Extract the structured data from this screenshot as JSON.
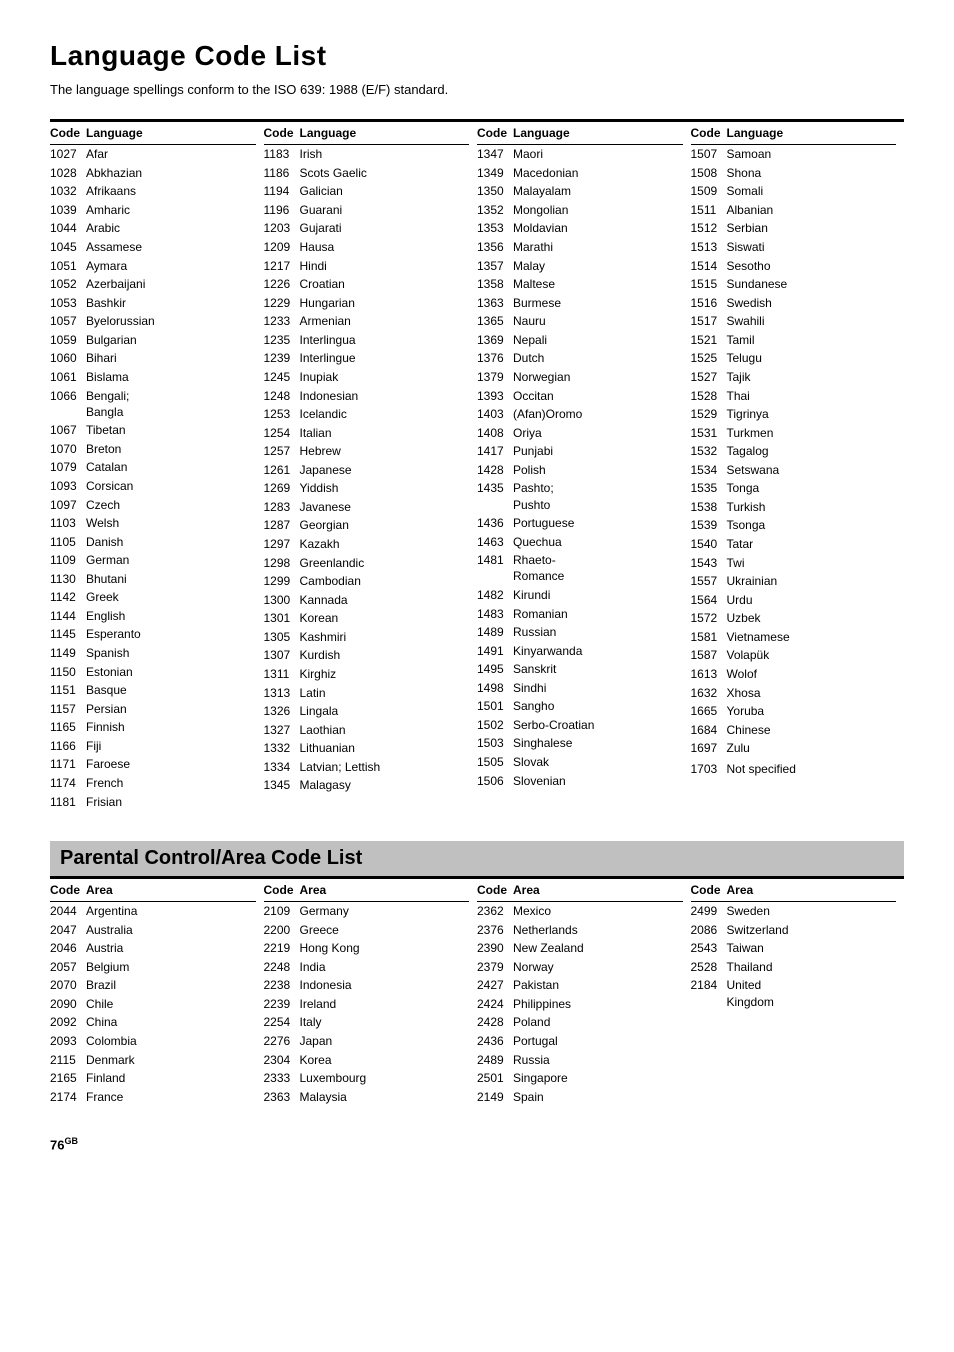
{
  "title": "Language Code List",
  "subtitle": "The language spellings conform to the ISO 639: 1988 (E/F) standard.",
  "lang_table_header": {
    "code": "Code",
    "language": "Language"
  },
  "lang_columns": [
    [
      {
        "code": "1027",
        "lang": "Afar"
      },
      {
        "code": "1028",
        "lang": "Abkhazian"
      },
      {
        "code": "1032",
        "lang": "Afrikaans"
      },
      {
        "code": "1039",
        "lang": "Amharic"
      },
      {
        "code": "1044",
        "lang": "Arabic"
      },
      {
        "code": "1045",
        "lang": "Assamese"
      },
      {
        "code": "1051",
        "lang": "Aymara"
      },
      {
        "code": "1052",
        "lang": "Azerbaijani"
      },
      {
        "code": "1053",
        "lang": "Bashkir"
      },
      {
        "code": "1057",
        "lang": "Byelorussian"
      },
      {
        "code": "1059",
        "lang": "Bulgarian"
      },
      {
        "code": "1060",
        "lang": "Bihari"
      },
      {
        "code": "1061",
        "lang": "Bislama"
      },
      {
        "code": "1066",
        "lang": "Bengali; Bangla"
      },
      {
        "code": "1067",
        "lang": "Tibetan"
      },
      {
        "code": "1070",
        "lang": "Breton"
      },
      {
        "code": "1079",
        "lang": "Catalan"
      },
      {
        "code": "1093",
        "lang": "Corsican"
      },
      {
        "code": "1097",
        "lang": "Czech"
      },
      {
        "code": "1103",
        "lang": "Welsh"
      },
      {
        "code": "1105",
        "lang": "Danish"
      },
      {
        "code": "1109",
        "lang": "German"
      },
      {
        "code": "1130",
        "lang": "Bhutani"
      },
      {
        "code": "1142",
        "lang": "Greek"
      },
      {
        "code": "1144",
        "lang": "English"
      },
      {
        "code": "1145",
        "lang": "Esperanto"
      },
      {
        "code": "1149",
        "lang": "Spanish"
      },
      {
        "code": "1150",
        "lang": "Estonian"
      },
      {
        "code": "1151",
        "lang": "Basque"
      },
      {
        "code": "1157",
        "lang": "Persian"
      },
      {
        "code": "1165",
        "lang": "Finnish"
      },
      {
        "code": "1166",
        "lang": "Fiji"
      },
      {
        "code": "1171",
        "lang": "Faroese"
      },
      {
        "code": "1174",
        "lang": "French"
      },
      {
        "code": "1181",
        "lang": "Frisian"
      }
    ],
    [
      {
        "code": "1183",
        "lang": "Irish"
      },
      {
        "code": "1186",
        "lang": "Scots Gaelic"
      },
      {
        "code": "1194",
        "lang": "Galician"
      },
      {
        "code": "1196",
        "lang": "Guarani"
      },
      {
        "code": "1203",
        "lang": "Gujarati"
      },
      {
        "code": "1209",
        "lang": "Hausa"
      },
      {
        "code": "1217",
        "lang": "Hindi"
      },
      {
        "code": "1226",
        "lang": "Croatian"
      },
      {
        "code": "1229",
        "lang": "Hungarian"
      },
      {
        "code": "1233",
        "lang": "Armenian"
      },
      {
        "code": "1235",
        "lang": "Interlingua"
      },
      {
        "code": "1239",
        "lang": "Interlingue"
      },
      {
        "code": "1245",
        "lang": "Inupiak"
      },
      {
        "code": "1248",
        "lang": "Indonesian"
      },
      {
        "code": "1253",
        "lang": "Icelandic"
      },
      {
        "code": "1254",
        "lang": "Italian"
      },
      {
        "code": "1257",
        "lang": "Hebrew"
      },
      {
        "code": "1261",
        "lang": "Japanese"
      },
      {
        "code": "1269",
        "lang": "Yiddish"
      },
      {
        "code": "1283",
        "lang": "Javanese"
      },
      {
        "code": "1287",
        "lang": "Georgian"
      },
      {
        "code": "1297",
        "lang": "Kazakh"
      },
      {
        "code": "1298",
        "lang": "Greenlandic"
      },
      {
        "code": "1299",
        "lang": "Cambodian"
      },
      {
        "code": "1300",
        "lang": "Kannada"
      },
      {
        "code": "1301",
        "lang": "Korean"
      },
      {
        "code": "1305",
        "lang": "Kashmiri"
      },
      {
        "code": "1307",
        "lang": "Kurdish"
      },
      {
        "code": "1311",
        "lang": "Kirghiz"
      },
      {
        "code": "1313",
        "lang": "Latin"
      },
      {
        "code": "1326",
        "lang": "Lingala"
      },
      {
        "code": "1327",
        "lang": "Laothian"
      },
      {
        "code": "1332",
        "lang": "Lithuanian"
      },
      {
        "code": "1334",
        "lang": "Latvian; Lettish"
      },
      {
        "code": "1345",
        "lang": "Malagasy"
      }
    ],
    [
      {
        "code": "1347",
        "lang": "Maori"
      },
      {
        "code": "1349",
        "lang": "Macedonian"
      },
      {
        "code": "1350",
        "lang": "Malayalam"
      },
      {
        "code": "1352",
        "lang": "Mongolian"
      },
      {
        "code": "1353",
        "lang": "Moldavian"
      },
      {
        "code": "1356",
        "lang": "Marathi"
      },
      {
        "code": "1357",
        "lang": "Malay"
      },
      {
        "code": "1358",
        "lang": "Maltese"
      },
      {
        "code": "1363",
        "lang": "Burmese"
      },
      {
        "code": "1365",
        "lang": "Nauru"
      },
      {
        "code": "1369",
        "lang": "Nepali"
      },
      {
        "code": "1376",
        "lang": "Dutch"
      },
      {
        "code": "1379",
        "lang": "Norwegian"
      },
      {
        "code": "1393",
        "lang": "Occitan"
      },
      {
        "code": "1403",
        "lang": "(Afan)Oromo"
      },
      {
        "code": "1408",
        "lang": "Oriya"
      },
      {
        "code": "1417",
        "lang": "Punjabi"
      },
      {
        "code": "1428",
        "lang": "Polish"
      },
      {
        "code": "1435",
        "lang": "Pashto; Pushto"
      },
      {
        "code": "1436",
        "lang": "Portuguese"
      },
      {
        "code": "1463",
        "lang": "Quechua"
      },
      {
        "code": "1481",
        "lang": "Rhaeto-Romance"
      },
      {
        "code": "1482",
        "lang": "Kirundi"
      },
      {
        "code": "1483",
        "lang": "Romanian"
      },
      {
        "code": "1489",
        "lang": "Russian"
      },
      {
        "code": "1491",
        "lang": "Kinyarwanda"
      },
      {
        "code": "1495",
        "lang": "Sanskrit"
      },
      {
        "code": "1498",
        "lang": "Sindhi"
      },
      {
        "code": "1501",
        "lang": "Sangho"
      },
      {
        "code": "1502",
        "lang": "Serbo-Croatian"
      },
      {
        "code": "1503",
        "lang": "Singhalese"
      },
      {
        "code": "1505",
        "lang": "Slovak"
      },
      {
        "code": "1506",
        "lang": "Slovenian"
      }
    ],
    [
      {
        "code": "1507",
        "lang": "Samoan"
      },
      {
        "code": "1508",
        "lang": "Shona"
      },
      {
        "code": "1509",
        "lang": "Somali"
      },
      {
        "code": "1511",
        "lang": "Albanian"
      },
      {
        "code": "1512",
        "lang": "Serbian"
      },
      {
        "code": "1513",
        "lang": "Siswati"
      },
      {
        "code": "1514",
        "lang": "Sesotho"
      },
      {
        "code": "1515",
        "lang": "Sundanese"
      },
      {
        "code": "1516",
        "lang": "Swedish"
      },
      {
        "code": "1517",
        "lang": "Swahili"
      },
      {
        "code": "1521",
        "lang": "Tamil"
      },
      {
        "code": "1525",
        "lang": "Telugu"
      },
      {
        "code": "1527",
        "lang": "Tajik"
      },
      {
        "code": "1528",
        "lang": "Thai"
      },
      {
        "code": "1529",
        "lang": "Tigrinya"
      },
      {
        "code": "1531",
        "lang": "Turkmen"
      },
      {
        "code": "1532",
        "lang": "Tagalog"
      },
      {
        "code": "1534",
        "lang": "Setswana"
      },
      {
        "code": "1535",
        "lang": "Tonga"
      },
      {
        "code": "1538",
        "lang": "Turkish"
      },
      {
        "code": "1539",
        "lang": "Tsonga"
      },
      {
        "code": "1540",
        "lang": "Tatar"
      },
      {
        "code": "1543",
        "lang": "Twi"
      },
      {
        "code": "1557",
        "lang": "Ukrainian"
      },
      {
        "code": "1564",
        "lang": "Urdu"
      },
      {
        "code": "1572",
        "lang": "Uzbek"
      },
      {
        "code": "1581",
        "lang": "Vietnamese"
      },
      {
        "code": "1587",
        "lang": "Volapük"
      },
      {
        "code": "1613",
        "lang": "Wolof"
      },
      {
        "code": "1632",
        "lang": "Xhosa"
      },
      {
        "code": "1665",
        "lang": "Yoruba"
      },
      {
        "code": "1684",
        "lang": "Chinese"
      },
      {
        "code": "1697",
        "lang": "Zulu"
      },
      {
        "code": "",
        "lang": ""
      },
      {
        "code": "1703",
        "lang": "Not specified"
      }
    ]
  ],
  "parental_title": "Parental Control/Area Code List",
  "area_table_header": {
    "code": "Code",
    "area": "Area"
  },
  "area_columns": [
    [
      {
        "code": "2044",
        "area": "Argentina"
      },
      {
        "code": "2047",
        "area": "Australia"
      },
      {
        "code": "2046",
        "area": "Austria"
      },
      {
        "code": "2057",
        "area": "Belgium"
      },
      {
        "code": "2070",
        "area": "Brazil"
      },
      {
        "code": "2090",
        "area": "Chile"
      },
      {
        "code": "2092",
        "area": "China"
      },
      {
        "code": "2093",
        "area": "Colombia"
      },
      {
        "code": "2115",
        "area": "Denmark"
      },
      {
        "code": "2165",
        "area": "Finland"
      },
      {
        "code": "2174",
        "area": "France"
      }
    ],
    [
      {
        "code": "2109",
        "area": "Germany"
      },
      {
        "code": "2200",
        "area": "Greece"
      },
      {
        "code": "2219",
        "area": "Hong Kong"
      },
      {
        "code": "2248",
        "area": "India"
      },
      {
        "code": "2238",
        "area": "Indonesia"
      },
      {
        "code": "2239",
        "area": "Ireland"
      },
      {
        "code": "2254",
        "area": "Italy"
      },
      {
        "code": "2276",
        "area": "Japan"
      },
      {
        "code": "2304",
        "area": "Korea"
      },
      {
        "code": "2333",
        "area": "Luxembourg"
      },
      {
        "code": "2363",
        "area": "Malaysia"
      }
    ],
    [
      {
        "code": "2362",
        "area": "Mexico"
      },
      {
        "code": "2376",
        "area": "Netherlands"
      },
      {
        "code": "2390",
        "area": "New Zealand"
      },
      {
        "code": "2379",
        "area": "Norway"
      },
      {
        "code": "2427",
        "area": "Pakistan"
      },
      {
        "code": "2424",
        "area": "Philippines"
      },
      {
        "code": "2428",
        "area": "Poland"
      },
      {
        "code": "2436",
        "area": "Portugal"
      },
      {
        "code": "2489",
        "area": "Russia"
      },
      {
        "code": "2501",
        "area": "Singapore"
      },
      {
        "code": "2149",
        "area": "Spain"
      }
    ],
    [
      {
        "code": "2499",
        "area": "Sweden"
      },
      {
        "code": "2086",
        "area": "Switzerland"
      },
      {
        "code": "2543",
        "area": "Taiwan"
      },
      {
        "code": "2528",
        "area": "Thailand"
      },
      {
        "code": "2184",
        "area": "United Kingdom"
      }
    ]
  ],
  "page_number": "76",
  "page_suffix": "GB"
}
